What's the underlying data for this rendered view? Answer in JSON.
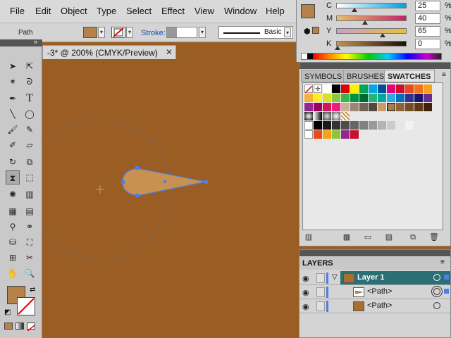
{
  "menubar": {
    "items": [
      "File",
      "Edit",
      "Object",
      "Type",
      "Select",
      "Effect",
      "View",
      "Window",
      "Help"
    ]
  },
  "control": {
    "selection_label": "Path",
    "stroke_label": "Stroke:",
    "brush_label": "Basic"
  },
  "document": {
    "tab_title": "-3* @ 200% (CMYK/Preview)",
    "close_glyph": "✕"
  },
  "color": {
    "fill_hex": "#b5834a",
    "cmyk": [
      {
        "letter": "C",
        "value": "25",
        "pct": "%"
      },
      {
        "letter": "M",
        "value": "40",
        "pct": "%"
      },
      {
        "letter": "Y",
        "value": "65",
        "pct": "%"
      },
      {
        "letter": "K",
        "value": "0",
        "pct": "%"
      }
    ]
  },
  "swatch_panel": {
    "tabs": [
      "SYMBOLS",
      "BRUSHES",
      "SWATCHES"
    ],
    "active_tab": "SWATCHES"
  },
  "layers_panel": {
    "title": "LAYERS",
    "rows": [
      {
        "name": "Layer 1"
      },
      {
        "name": "<Path>"
      },
      {
        "name": "<Path>"
      }
    ]
  },
  "colors": {
    "canvas_bg": "#9a5e24",
    "shape_fill": "#c8914f",
    "selection_blue": "#4a7ee8",
    "layer_highlight": "#2a6f73"
  }
}
